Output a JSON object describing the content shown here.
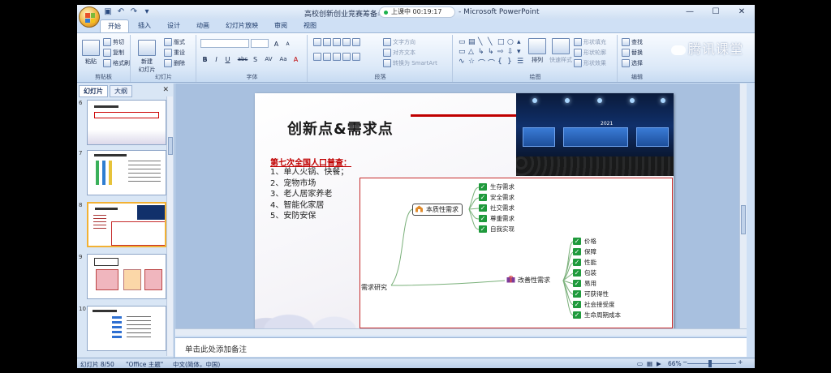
{
  "window": {
    "title": "高校创新创业竞赛筹备与利",
    "app_name": "- Microsoft PowerPoint",
    "live_status": "上课中 00:19:17",
    "min": "—",
    "max": "☐",
    "close": "✕"
  },
  "tabs": [
    "开始",
    "插入",
    "设计",
    "动画",
    "幻灯片放映",
    "审阅",
    "视图"
  ],
  "ribbon": {
    "clipboard": {
      "title": "剪贴板",
      "paste": "粘贴",
      "cut": "剪切",
      "copy": "复制",
      "format_painter": "格式刷"
    },
    "slides": {
      "title": "幻灯片",
      "new_slide": "新建\n幻灯片",
      "layout": "版式",
      "reset": "重设",
      "delete": "删除"
    },
    "font": {
      "title": "字体",
      "bold": "B",
      "italic": "I",
      "underline": "U",
      "strike": "abc",
      "shadow": "S",
      "spacing": "AV",
      "case": "Aa",
      "grow": "A",
      "shrink": "A"
    },
    "paragraph": {
      "title": "段落",
      "text_direction": "文字方向",
      "align_text": "对齐文本",
      "smartart": "转换为 SmartArt"
    },
    "drawing": {
      "title": "绘图",
      "arrange": "排列",
      "quick_styles": "快速样式",
      "shape_fill": "形状填充",
      "shape_outline": "形状轮廓",
      "shape_effects": "形状效果"
    },
    "editing": {
      "title": "编辑",
      "find": "查找",
      "replace": "替换",
      "select": "选择"
    }
  },
  "watermark": "腾讯课堂",
  "left_panel": {
    "tab_slides": "幻灯片",
    "tab_outline": "大纲",
    "close": "✕",
    "thumbnails": [
      {
        "num": "6"
      },
      {
        "num": "7"
      },
      {
        "num": "8"
      },
      {
        "num": "9"
      },
      {
        "num": "10"
      }
    ]
  },
  "slide": {
    "title": "创新点&需求点",
    "census_heading": "第七次全国人口普查：",
    "census_items": [
      "1、单人火锅、快餐；",
      "2、宠物市场",
      "3、老人居家养老",
      "4、智能化家居",
      "5、安防安保"
    ],
    "photo_year": "2021",
    "mindmap": {
      "root": "需求研究",
      "node_basic": "本质性需求",
      "basic_items": [
        "生存需求",
        "安全需求",
        "社交需求",
        "尊重需求",
        "自我实现"
      ],
      "node_improve": "改善性需求",
      "improve_items": [
        "价格",
        "保障",
        "性能",
        "包装",
        "易用",
        "可获得性",
        "社会接受度",
        "生命周期成本"
      ]
    }
  },
  "notes_placeholder": "单击此处添加备注",
  "status": {
    "slide_info": "幻灯片 8/50",
    "theme": "\"Office 主题\"",
    "language": "中文(简体，中国)",
    "zoom": "66%"
  },
  "colors": {
    "accent_red": "#c00000",
    "check_green": "#1f9a3c",
    "ribbon_bg": "#dce9f8"
  }
}
